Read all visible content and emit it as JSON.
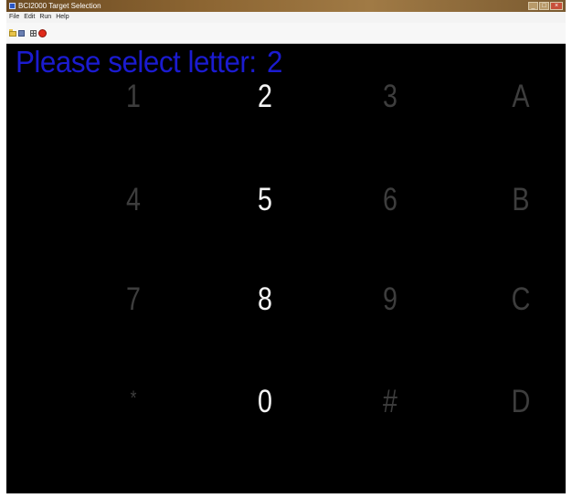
{
  "window": {
    "title": "BCI2000 Target Selection",
    "controls": [
      "_",
      "□",
      "×"
    ]
  },
  "menu": [
    "File",
    "Edit",
    "Run",
    "Help"
  ],
  "toolbar": [
    {
      "name": "open-icon"
    },
    {
      "name": "save-icon"
    },
    {
      "name": "grid-icon"
    },
    {
      "name": "stop-icon"
    }
  ],
  "prompt": {
    "text": "Please select letter:",
    "letter": "2"
  },
  "colors": {
    "prompt": "#1b1bd0",
    "active_key": "#f4f4f4",
    "inactive_key": "#3d3d3d",
    "background": "#000000"
  },
  "keypad": {
    "highlighted_column": 2,
    "rows": [
      [
        "1",
        "2",
        "3",
        "A"
      ],
      [
        "4",
        "5",
        "6",
        "B"
      ],
      [
        "7",
        "8",
        "9",
        "C"
      ],
      [
        "*",
        "0",
        "#",
        "D"
      ]
    ]
  }
}
